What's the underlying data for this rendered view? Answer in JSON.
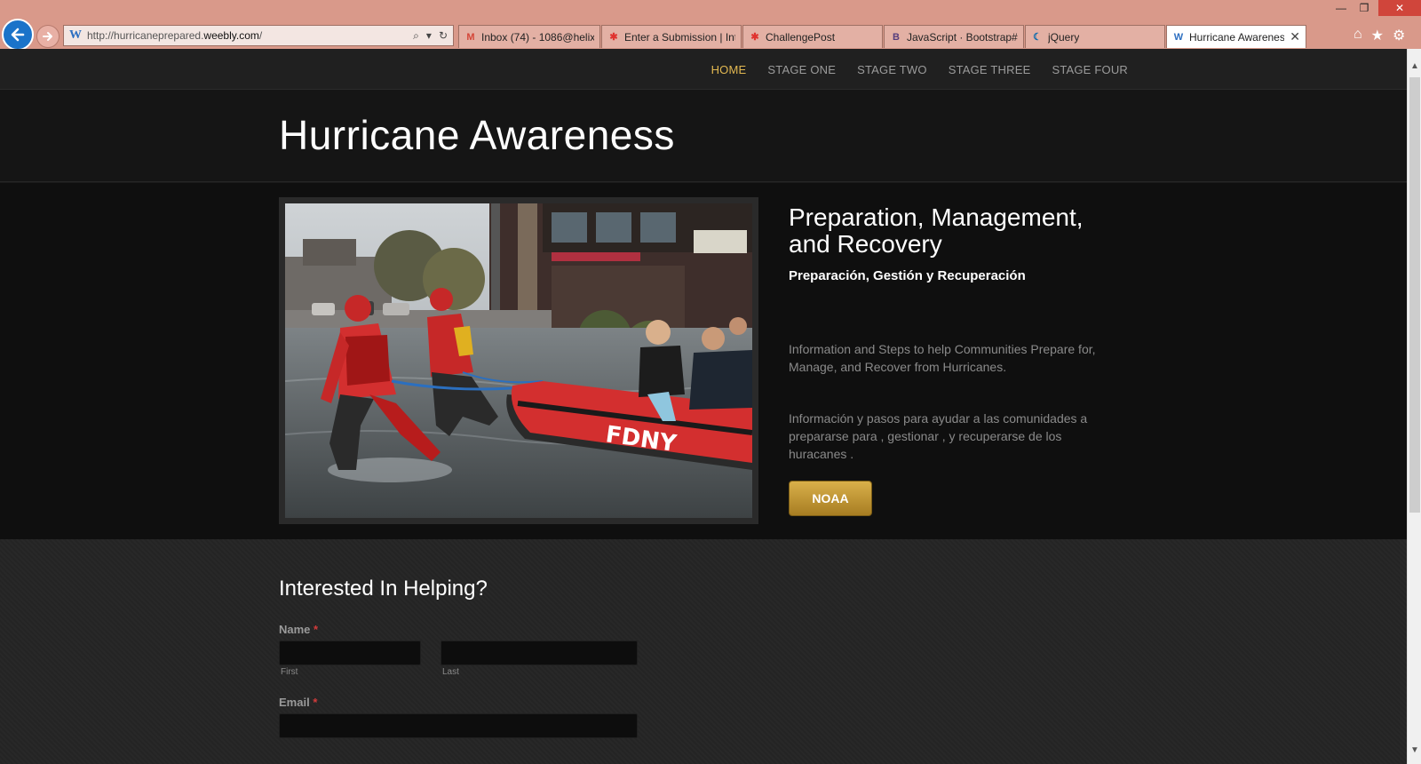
{
  "browser": {
    "window_controls": {
      "minimize": "—",
      "restore": "❐",
      "close": "✕"
    },
    "address": {
      "prefix": "http://hurricaneprepared.",
      "domain": "weebly.com",
      "suffix": "/"
    },
    "tabs": [
      {
        "label": "Inbox (74) - 1086@helix...",
        "icon": "gmail-icon",
        "icon_glyph": "M",
        "icon_color": "#d44638"
      },
      {
        "label": "Enter a Submission | Int...",
        "icon": "colorful-star-icon",
        "icon_glyph": "✱",
        "icon_color": "#e0332f"
      },
      {
        "label": "ChallengePost",
        "icon": "colorful-star-icon",
        "icon_glyph": "✱",
        "icon_color": "#e0332f"
      },
      {
        "label": "JavaScript · Bootstrap#...",
        "icon": "bootstrap-icon",
        "icon_glyph": "B",
        "icon_color": "#563d7c"
      },
      {
        "label": "jQuery",
        "icon": "jquery-icon",
        "icon_glyph": "☾",
        "icon_color": "#0769ad"
      },
      {
        "label": "Hurricane Awarenes...",
        "icon": "weebly-icon",
        "icon_glyph": "W",
        "icon_color": "#2d6fc1",
        "active": true
      }
    ]
  },
  "site": {
    "nav": [
      {
        "label": "HOME",
        "active": true
      },
      {
        "label": "STAGE ONE"
      },
      {
        "label": "STAGE TWO"
      },
      {
        "label": "STAGE THREE"
      },
      {
        "label": "STAGE FOUR"
      }
    ],
    "title": "Hurricane Awareness",
    "hero": {
      "heading": "Preparation, Management, and Recovery",
      "subheading": "Preparación, Gestión y Recuperación",
      "paragraph_en": "Information and Steps to help Communities Prepare for, Manage, and Recover from Hurricanes.",
      "paragraph_es": "Información y pasos para ayudar a las comunidades a prepararse para , gestionar , y recuperarse de los huracanes .",
      "button": "NOAA",
      "boat_text": "FDNY"
    },
    "form": {
      "title": "Interested In Helping?",
      "name_label": "Name",
      "required_mark": "*",
      "first_label": "First",
      "last_label": "Last",
      "email_label": "Email"
    }
  },
  "colors": {
    "nav_active": "#e2b851",
    "button_gold": "#c99a35",
    "chrome_bg": "#d9998a"
  }
}
